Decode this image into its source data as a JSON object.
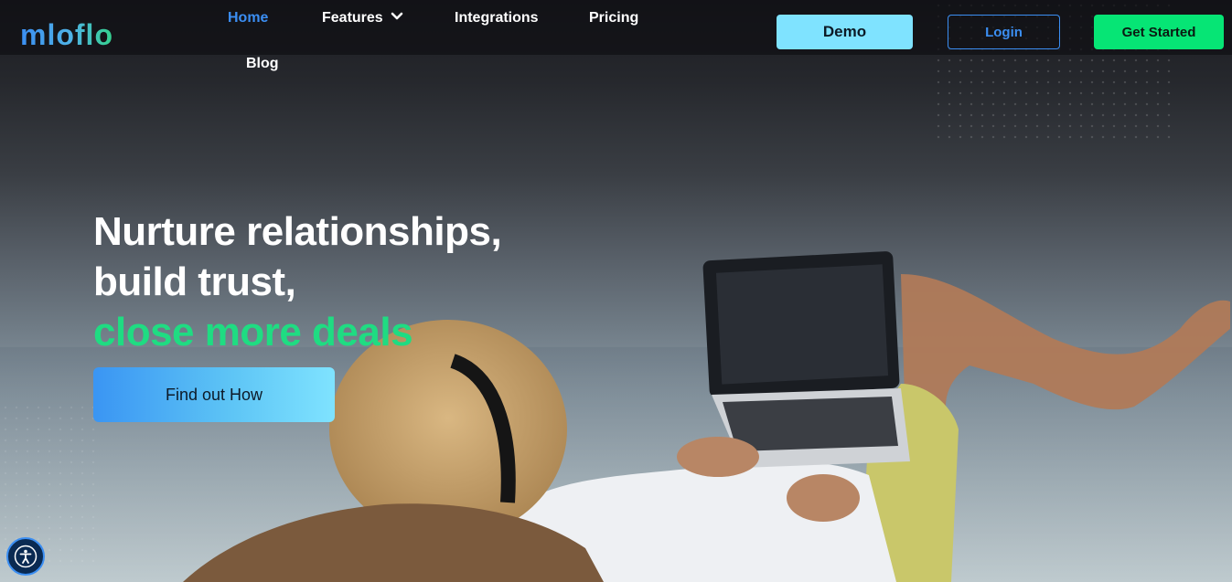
{
  "brand": {
    "logo_text": "mloflo"
  },
  "nav": {
    "items": [
      {
        "label": "Home",
        "active": true
      },
      {
        "label": "Features",
        "has_dropdown": true
      },
      {
        "label": "Integrations"
      },
      {
        "label": "Pricing"
      },
      {
        "label": "Blog"
      }
    ]
  },
  "actions": {
    "demo_label": "Demo",
    "login_label": "Login",
    "get_started_label": "Get Started"
  },
  "hero": {
    "line1": "Nurture relationships,",
    "line2": "build trust,",
    "line3": "close more deals",
    "cta_label": "Find out How"
  },
  "icons": {
    "features_dropdown": "chevron-down-icon",
    "accessibility": "accessibility-icon"
  },
  "colors": {
    "accent_blue": "#3b8ef2",
    "accent_green": "#1fdc82",
    "demo_bg": "#7fe3ff",
    "get_started_bg": "#06e575"
  }
}
